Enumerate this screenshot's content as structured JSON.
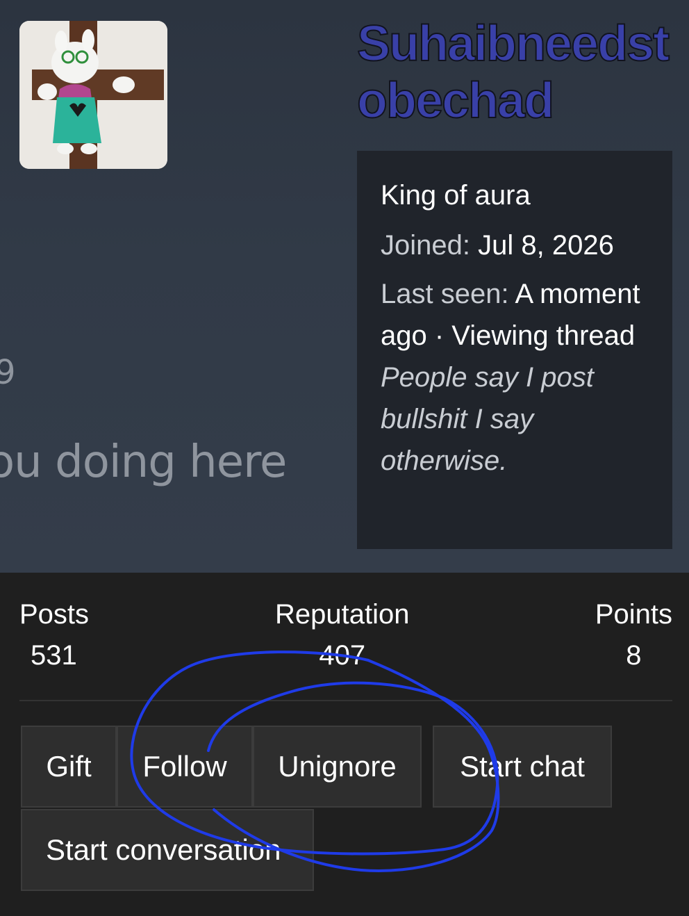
{
  "profile": {
    "username": "Suhaibneedstobechad",
    "title": "King of aura",
    "joined_label": "Joined:",
    "joined_value": "Jul 8, 2026",
    "last_seen_label": "Last seen:",
    "last_seen_value": "A moment ago · Viewing thread",
    "signature": "People say I post bullshit I say otherwise."
  },
  "banner": {
    "fragment_number": "9",
    "fragment_text": "ou doing here"
  },
  "stats": {
    "posts_label": "Posts",
    "posts_value": "531",
    "reputation_label": "Reputation",
    "reputation_value": "407",
    "points_label": "Points",
    "points_value": "8"
  },
  "actions": {
    "gift": "Gift",
    "follow": "Follow",
    "unignore": "Unignore",
    "start_chat": "Start chat",
    "start_conversation": "Start conversation"
  },
  "colors": {
    "username": "#3940a8",
    "scribble": "#1f3be8",
    "button_bg": "#2e2e2e",
    "info_box_bg": "#20242b"
  }
}
